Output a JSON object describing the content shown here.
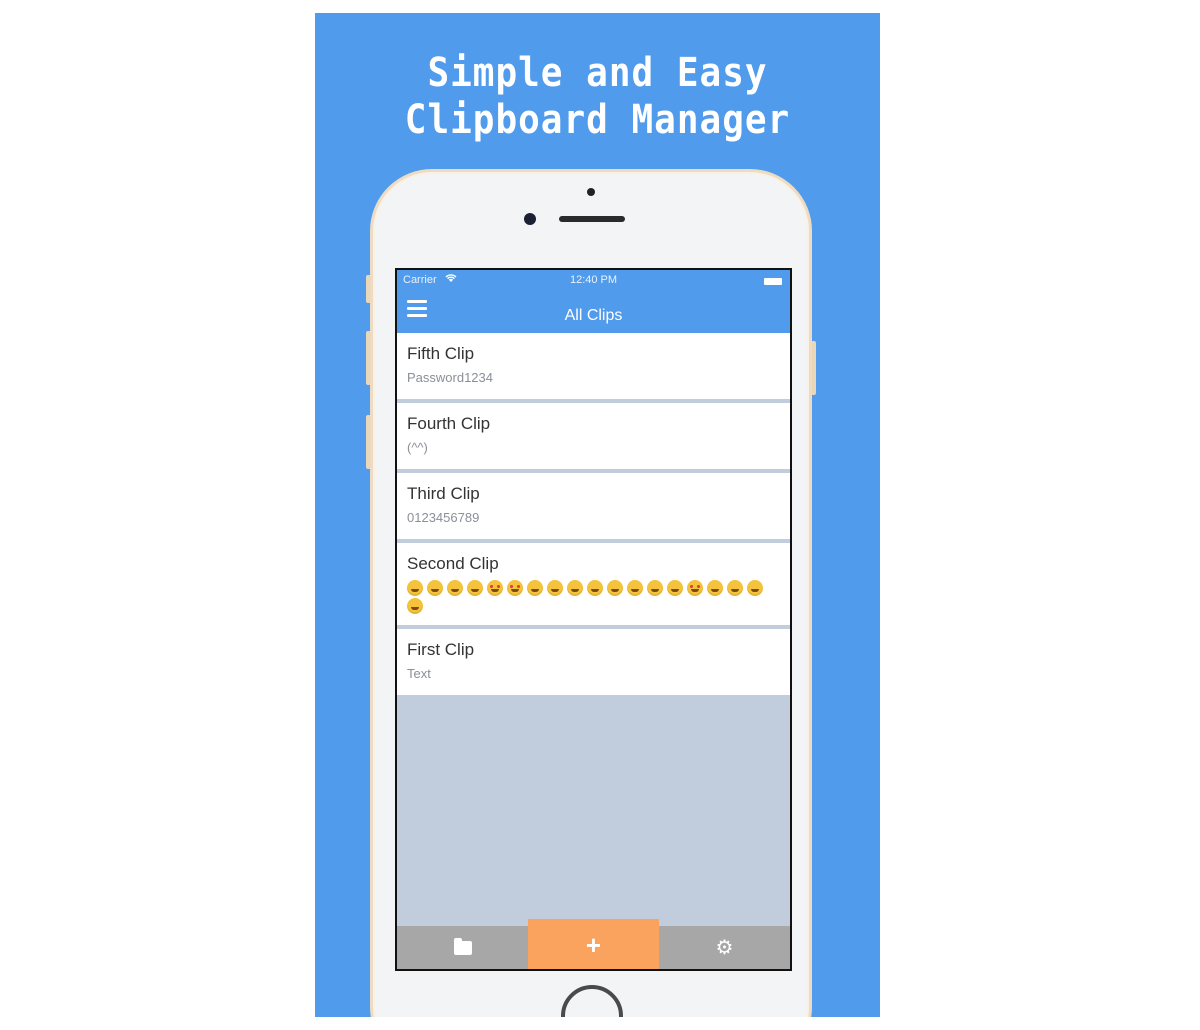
{
  "banner": {
    "headline_line1": "Simple and Easy",
    "headline_line2": "Clipboard Manager",
    "background_color": "#519bec"
  },
  "status_bar": {
    "carrier": "Carrier",
    "wifi_icon": "wifi-icon",
    "time": "12:40 PM",
    "battery_icon": "battery-icon"
  },
  "navbar": {
    "title": "All Clips",
    "menu_icon": "hamburger-menu-icon"
  },
  "clips": [
    {
      "title": "Fifth Clip",
      "preview": "Password1234"
    },
    {
      "title": "Fourth Clip",
      "preview": "(^^)"
    },
    {
      "title": "Third Clip",
      "preview": "0123456789"
    },
    {
      "title": "Second Clip",
      "preview_type": "emoji",
      "emoji_count": 19
    },
    {
      "title": "First Clip",
      "preview": "Text"
    }
  ],
  "tabbar": {
    "folder_icon": "folder-icon",
    "add_icon": "plus-icon",
    "settings_icon": "gear-icon",
    "add_color": "#f9a35f",
    "bar_color": "#a7a7a7"
  }
}
